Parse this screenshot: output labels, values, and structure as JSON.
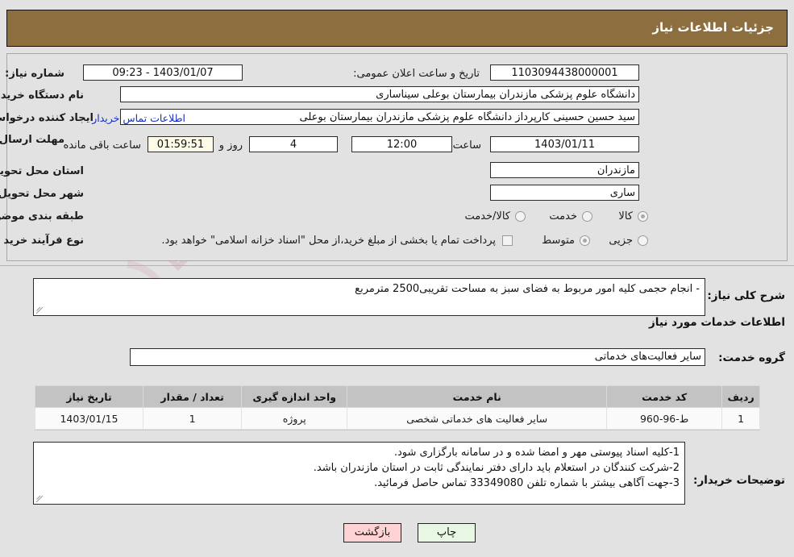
{
  "header": {
    "title": "جزئیات اطلاعات نیاز"
  },
  "watermark": {
    "text_main": "iranTender",
    "text_accent": ".net",
    "prefix": ""
  },
  "form": {
    "need_number_label": "شماره نیاز:",
    "need_number_value": "1103094438000001",
    "announce_label": "تاریخ و ساعت اعلان عمومی:",
    "announce_value": "09:23 - 1403/01/07",
    "buyer_org_label": "نام دستگاه خریدار:",
    "buyer_org_value": "دانشگاه علوم پزشکی مازندران بیمارستان بوعلی سیناساری",
    "requester_label": "ایجاد کننده درخواست:",
    "requester_value": "سید حسین حسینی کارپرداز دانشگاه علوم پزشکی مازندران بیمارستان بوعلی",
    "buyer_contact_link": "اطلاعات تماس خریدار",
    "deadline_label": "مهلت ارسال پاسخ: تا تاریخ:",
    "deadline_date": "1403/01/11",
    "deadline_time_label": "ساعت",
    "deadline_time": "12:00",
    "remaining_days": "4",
    "remaining_days_label": "روز و",
    "remaining_clock": "01:59:51",
    "remaining_suffix": "ساعت باقی مانده",
    "province_label": "استان محل تحویل:",
    "province_value": "مازندران",
    "city_label": "شهر محل تحویل:",
    "city_value": "ساری",
    "category_label": "طبقه بندی موضوعی:",
    "category_options": [
      "کالا",
      "خدمت",
      "کالا/خدمت"
    ],
    "category_selected": "کالا",
    "process_label": "نوع فرآیند خرید :",
    "process_options": [
      "جزیی",
      "متوسط"
    ],
    "process_selected": "متوسط",
    "treasury_checkbox_label": "پرداخت تمام یا بخشی از مبلغ خرید،از محل \"اسناد خزانه اسلامی\" خواهد بود.",
    "treasury_checked": false
  },
  "description": {
    "label": "شرح کلی نیاز:",
    "value": "- انجام حجمی کلیه امور مربوط به فضای سبز به مساحت تقریبی2500 مترمربع"
  },
  "services": {
    "section_title": "اطلاعات خدمات مورد نیاز",
    "group_label": "گروه خدمت:",
    "group_value": "سایر فعالیت‌های خدماتی",
    "columns": [
      "ردیف",
      "کد خدمت",
      "نام خدمت",
      "واحد اندازه گیری",
      "تعداد / مقدار",
      "تاریخ نیاز"
    ],
    "rows": [
      {
        "row": "1",
        "code": "ط-96-960",
        "name": "سایر فعالیت های خدماتی شخصی",
        "unit": "پروژه",
        "qty": "1",
        "date": "1403/01/15"
      }
    ]
  },
  "buyer_notes": {
    "label": "توضیحات خریدار:",
    "lines": [
      "1-کلیه اسناد پیوستی مهر و امضا شده و در سامانه بارگزاری شود.",
      "2-شرکت کنندگان در استعلام باید دارای دفتر نمایندگی ثابت در استان مازندران باشد.",
      "3-جهت آگاهی بیشتر با شماره تلفن 33349080 تماس حاصل فرمائید."
    ]
  },
  "footer": {
    "print_label": "چاپ",
    "back_label": "بازگشت"
  },
  "colors": {
    "header_bg": "#8d6e3f",
    "page_bg": "#e2e2e2",
    "link": "#1530c4",
    "table_header_bg": "#c3c3c3",
    "print_btn_bg": "#e8f6e4",
    "back_btn_bg": "#ffd3d3",
    "countdown_bg": "#fdfbe8"
  }
}
